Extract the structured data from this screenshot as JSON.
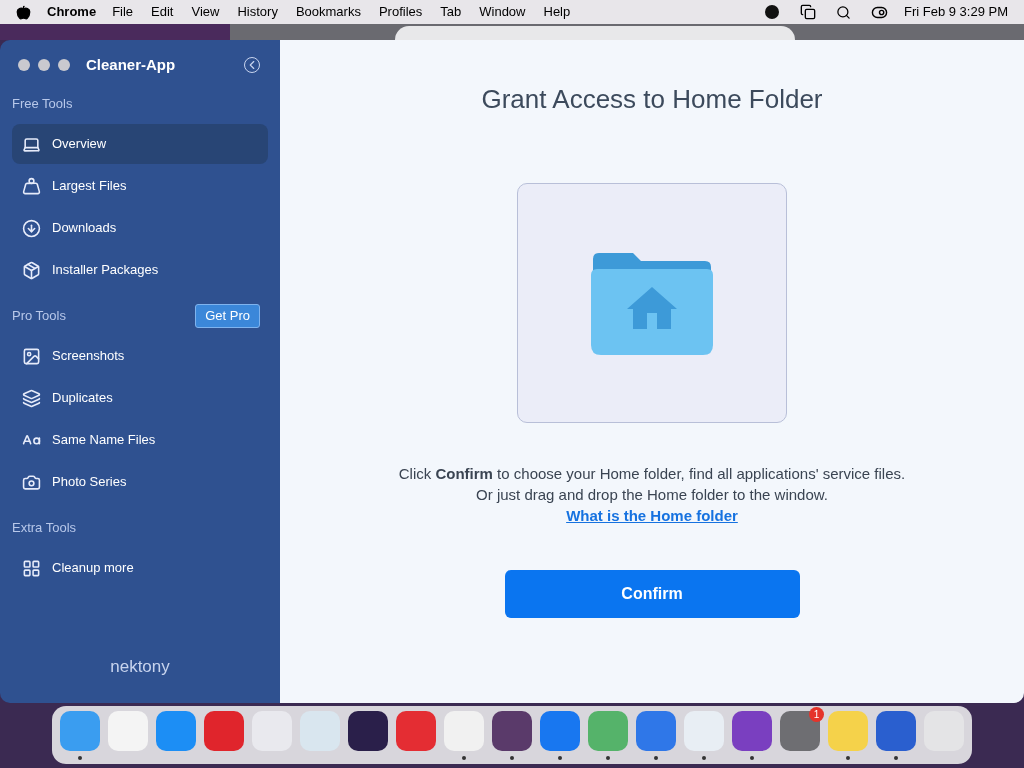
{
  "menu_bar": {
    "app": "Chrome",
    "items": [
      "File",
      "Edit",
      "View",
      "History",
      "Bookmarks",
      "Profiles",
      "Tab",
      "Window",
      "Help"
    ],
    "clock": "Fri Feb 9  3:29 PM"
  },
  "window": {
    "title": "Cleaner-App"
  },
  "sidebar": {
    "sections": [
      {
        "title": "Free Tools",
        "items": [
          {
            "label": "Overview",
            "selected": true
          },
          {
            "label": "Largest Files",
            "selected": false
          },
          {
            "label": "Downloads",
            "selected": false
          },
          {
            "label": "Installer Packages",
            "selected": false
          }
        ]
      },
      {
        "title": "Pro Tools",
        "badge": "Get Pro",
        "items": [
          {
            "label": "Screenshots",
            "selected": false
          },
          {
            "label": "Duplicates",
            "selected": false
          },
          {
            "label": "Same Name Files",
            "selected": false
          },
          {
            "label": "Photo Series",
            "selected": false
          }
        ]
      },
      {
        "title": "Extra Tools",
        "items": [
          {
            "label": "Cleanup more",
            "selected": false
          }
        ]
      }
    ],
    "brand": "nektony"
  },
  "main": {
    "heading": "Grant Access to Home Folder",
    "description": "Click **Confirm** to choose your Home folder, find all applications' service files.",
    "description_2": "Or just drag and drop the Home folder to the window.",
    "link": "What is the Home folder",
    "button": "Confirm"
  },
  "dock": {
    "apps": [
      {
        "color": "#3a9df0",
        "running": true
      },
      {
        "color": "#f4f4f4",
        "running": false
      },
      {
        "color": "#1c8ef5",
        "running": false
      },
      {
        "color": "#e0252c",
        "running": false
      },
      {
        "color": "#e9e9ee",
        "running": false
      },
      {
        "color": "#d9e6ef",
        "running": false
      },
      {
        "color": "#2a1f4a",
        "running": false
      },
      {
        "color": "#e42d33",
        "running": false
      },
      {
        "color": "#f1f1f1",
        "running": true
      },
      {
        "color": "#5a3a6a",
        "running": true
      },
      {
        "color": "#1877f0",
        "running": true
      },
      {
        "color": "#55b36a",
        "running": true
      },
      {
        "color": "#2f77e8",
        "running": true
      },
      {
        "color": "#e8eef4",
        "running": true
      },
      {
        "color": "#7a3fc0",
        "running": true
      },
      {
        "color": "#6e6e72",
        "running": false,
        "badge": "1"
      },
      {
        "color": "#f5d24a",
        "running": true
      },
      {
        "color": "#2a5fcf",
        "running": true
      },
      {
        "color": "#e4e4e6",
        "running": false
      }
    ]
  }
}
